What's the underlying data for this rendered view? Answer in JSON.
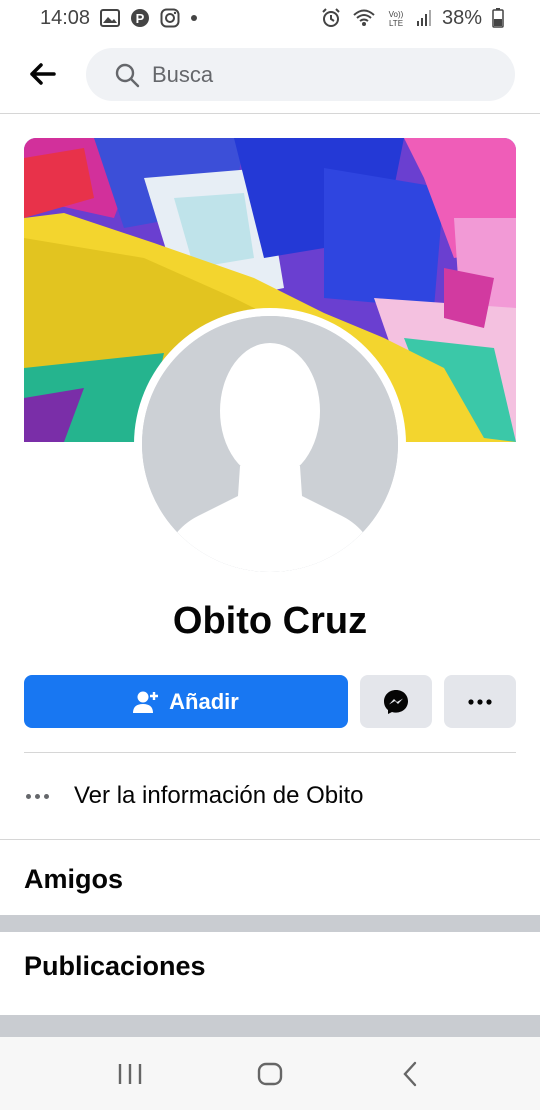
{
  "status_bar": {
    "time": "14:08",
    "battery": "38%",
    "notification_icons": [
      "gallery-icon",
      "pinterest-icon",
      "instagram-icon",
      "dot-icon"
    ],
    "system_icons": [
      "alarm-icon",
      "wifi-icon",
      "volte-icon",
      "signal-icon",
      "battery-icon"
    ]
  },
  "top_nav": {
    "search_placeholder": "Busca"
  },
  "profile": {
    "name": "Obito Cruz",
    "add_label": "Añadir",
    "info_label": "Ver la información de Obito"
  },
  "sections": {
    "friends": "Amigos",
    "posts": "Publicaciones"
  },
  "colors": {
    "accent": "#1877f2",
    "secondary_button": "#e4e6eb",
    "avatar_placeholder": "#ccd0d5"
  }
}
